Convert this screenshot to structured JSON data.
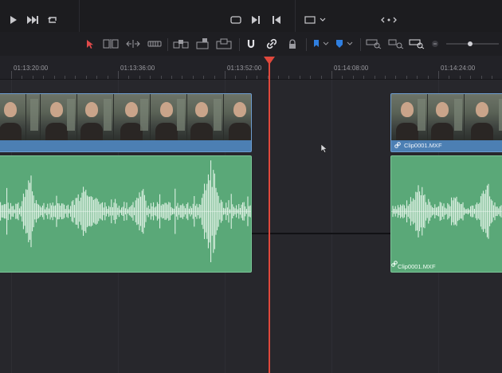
{
  "timeline": {
    "timecodes": [
      "01:13:20:00",
      "01:13:36:00",
      "01:13:52:00",
      "01:14:08:00",
      "01:14:24:00"
    ]
  },
  "clips": {
    "video_right_name": "Clip0001.MXF",
    "audio_right_name": "Clip0001.MXF"
  },
  "transport": {
    "icons": [
      "play-icon",
      "skip-end-icon",
      "loop-icon",
      "match-frame-icon",
      "next-edit-icon",
      "prev-edit-icon",
      "viewer-size-icon",
      "nav-arrows-icon"
    ]
  },
  "colors": {
    "playhead": "#e0483c",
    "video_clip": "#4c7fb3",
    "audio_clip": "#5aa878",
    "flag": "#2f7fe0"
  }
}
